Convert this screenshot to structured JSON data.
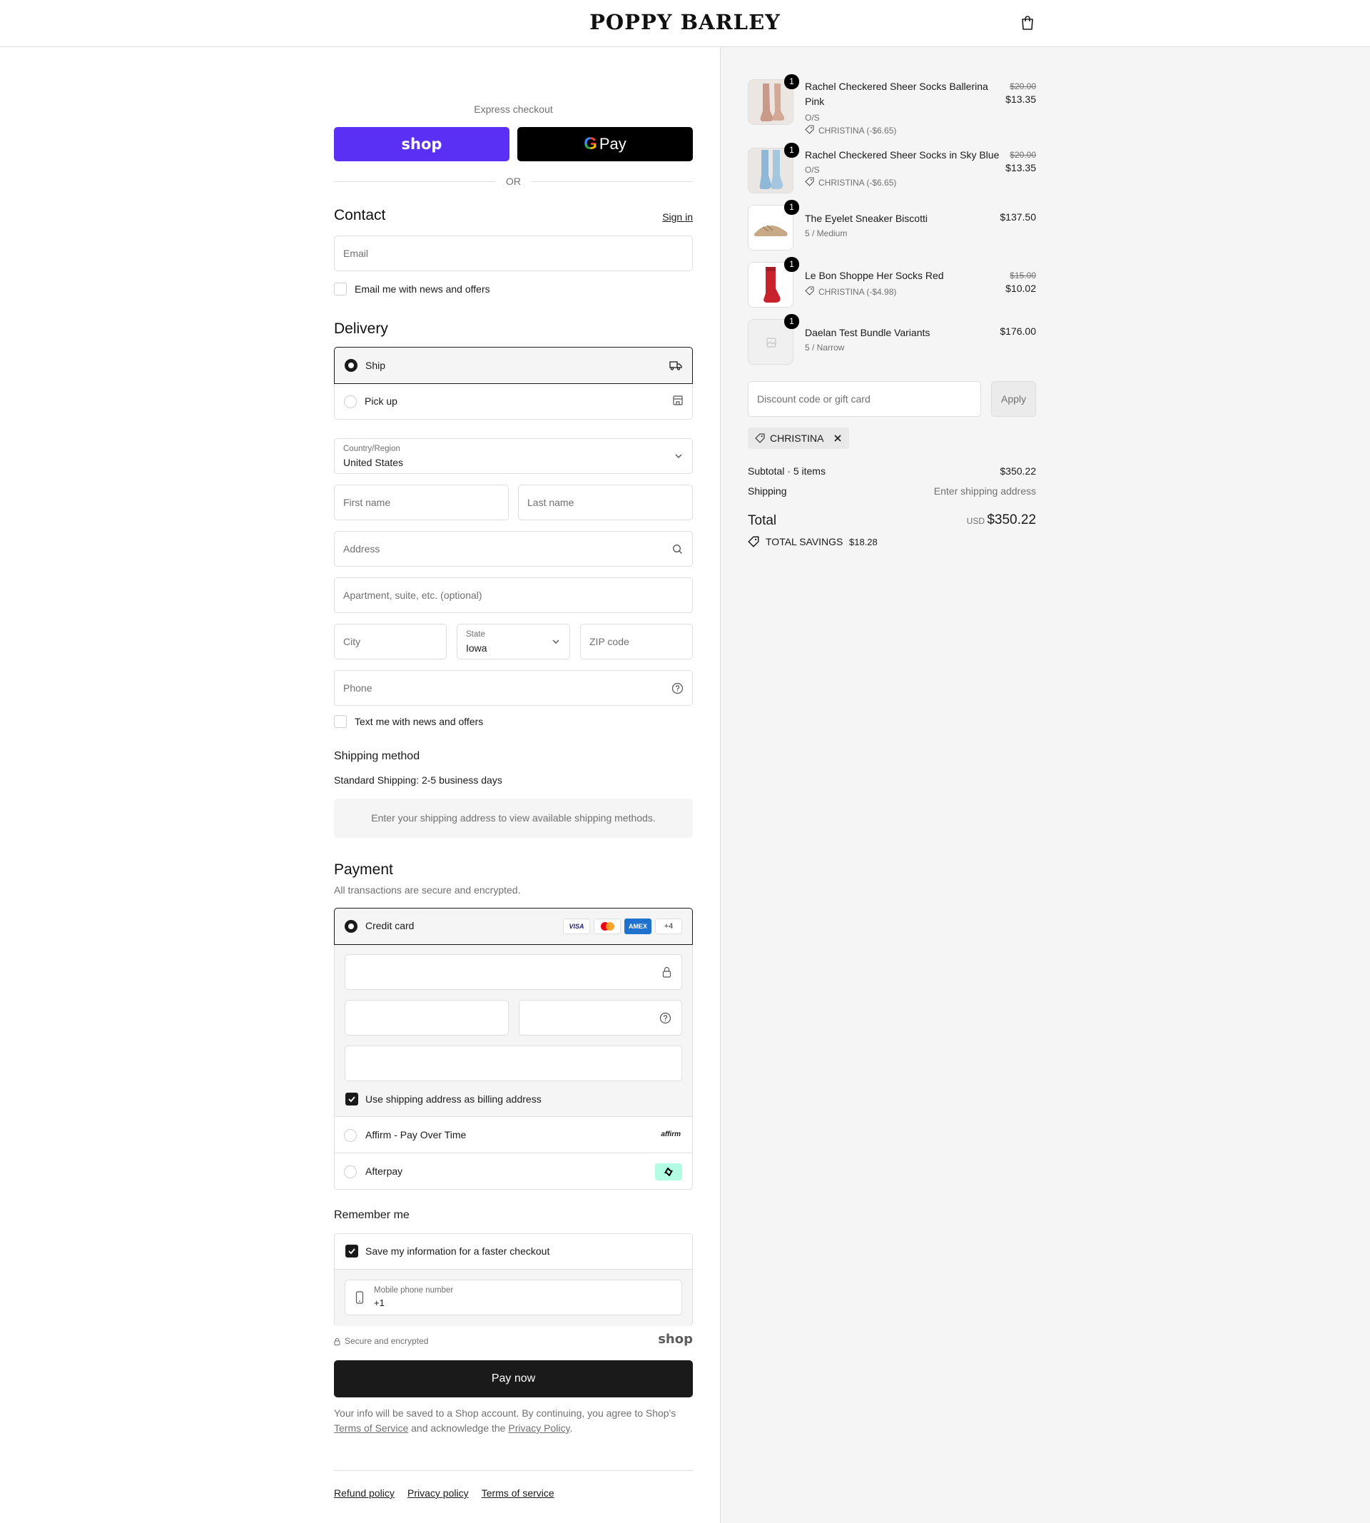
{
  "header": {
    "brand": "POPPY BARLEY"
  },
  "express": {
    "label": "Express checkout",
    "shop_label": "shop",
    "gpay_label": "Pay",
    "or": "OR"
  },
  "contact": {
    "title": "Contact",
    "sign_in": "Sign in",
    "email_placeholder": "Email",
    "news_label": "Email me with news and offers"
  },
  "delivery": {
    "title": "Delivery",
    "options": [
      {
        "label": "Ship",
        "selected": true
      },
      {
        "label": "Pick up",
        "selected": false
      }
    ],
    "country_label": "Country/Region",
    "country_value": "United States",
    "first_name": "First name",
    "last_name": "Last name",
    "address": "Address",
    "apartment": "Apartment, suite, etc. (optional)",
    "city": "City",
    "state_label": "State",
    "state_value": "Iowa",
    "zip": "ZIP code",
    "phone": "Phone",
    "text_label": "Text me with news and offers"
  },
  "shipping_method": {
    "title": "Shipping method",
    "standard": "Standard Shipping: 2-5 business days",
    "note": "Enter your shipping address to view available shipping methods."
  },
  "payment": {
    "title": "Payment",
    "subtitle": "All transactions are secure and encrypted.",
    "credit_card": "Credit card",
    "card_more": "+4",
    "cards": {
      "visa": "VISA",
      "amex": "AMEX"
    },
    "billing_label": "Use shipping address as billing address",
    "affirm": "Affirm - Pay Over Time",
    "affirm_logo": "affirm",
    "afterpay": "Afterpay"
  },
  "remember": {
    "title": "Remember me",
    "save_label": "Save my information for a faster checkout",
    "mobile_label": "Mobile phone number",
    "mobile_value": "+1"
  },
  "secure": {
    "text": "Secure and encrypted",
    "shop": "shop"
  },
  "pay_now": "Pay now",
  "legal": {
    "line1": "Your info will be saved to a Shop account. By continuing, you agree to Shop's",
    "terms": "Terms of Service",
    "and": "and acknowledge the",
    "privacy": "Privacy Policy",
    "end": "."
  },
  "footer": {
    "refund": "Refund policy",
    "privacy": "Privacy policy",
    "terms": "Terms of service"
  },
  "cart": {
    "items": [
      {
        "qty": "1",
        "title1": "Rachel Checkered Sheer Socks Ballerina",
        "title2": "Pink",
        "variant": "O/S",
        "discount": "CHRISTINA (-$6.65)",
        "original": "$20.00",
        "price": "$13.35"
      },
      {
        "qty": "1",
        "title1": "Rachel Checkered Sheer Socks in Sky Blue",
        "variant": "O/S",
        "discount": "CHRISTINA (-$6.65)",
        "original": "$20.00",
        "price": "$13.35"
      },
      {
        "qty": "1",
        "title1": "The Eyelet Sneaker Biscotti",
        "variant": "5 / Medium",
        "price": "$137.50"
      },
      {
        "qty": "1",
        "title1": "Le Bon Shoppe Her Socks Red",
        "discount": "CHRISTINA (-$4.98)",
        "original": "$15.00",
        "price": "$10.02"
      },
      {
        "qty": "1",
        "title1": "Daelan Test Bundle Variants",
        "variant": "5 / Narrow",
        "price": "$176.00"
      }
    ],
    "discount_placeholder": "Discount code or gift card",
    "apply": "Apply",
    "code": "CHRISTINA",
    "subtotal_label": "Subtotal · 5 items",
    "subtotal": "$350.22",
    "shipping_label": "Shipping",
    "shipping_value": "Enter shipping address",
    "total_label": "Total",
    "currency": "USD",
    "total": "$350.22",
    "savings_label": "TOTAL SAVINGS",
    "savings": "$18.28"
  },
  "colors": {
    "shop_purple": "#5a31f4",
    "accent": "#1a1a1a",
    "afterpay": "#b2fce4"
  }
}
